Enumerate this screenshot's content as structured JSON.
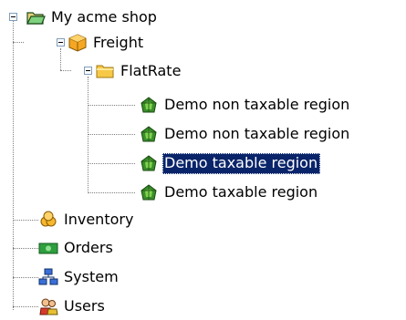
{
  "tree": {
    "root": {
      "label": "My acme shop",
      "icon": "open-folder-icon",
      "expanded": true
    },
    "freight": {
      "label": "Freight",
      "icon": "freight-box-icon",
      "expanded": true
    },
    "flatrate": {
      "label": "FlatRate",
      "icon": "folder-icon",
      "expanded": true
    },
    "regions": [
      {
        "label": "Demo non taxable region",
        "icon": "region-icon",
        "selected": false
      },
      {
        "label": "Demo non taxable region",
        "icon": "region-icon",
        "selected": false
      },
      {
        "label": "Demo taxable region",
        "icon": "region-icon",
        "selected": true
      },
      {
        "label": "Demo taxable region",
        "icon": "region-icon",
        "selected": false
      }
    ],
    "inventory": {
      "label": "Inventory",
      "icon": "inventory-icon"
    },
    "orders": {
      "label": "Orders",
      "icon": "orders-icon"
    },
    "system": {
      "label": "System",
      "icon": "system-network-icon"
    },
    "users": {
      "label": "Users",
      "icon": "users-icon"
    }
  },
  "colors": {
    "selection_background": "#0a246a",
    "selection_text": "#ffffff",
    "connector": "#808080"
  }
}
